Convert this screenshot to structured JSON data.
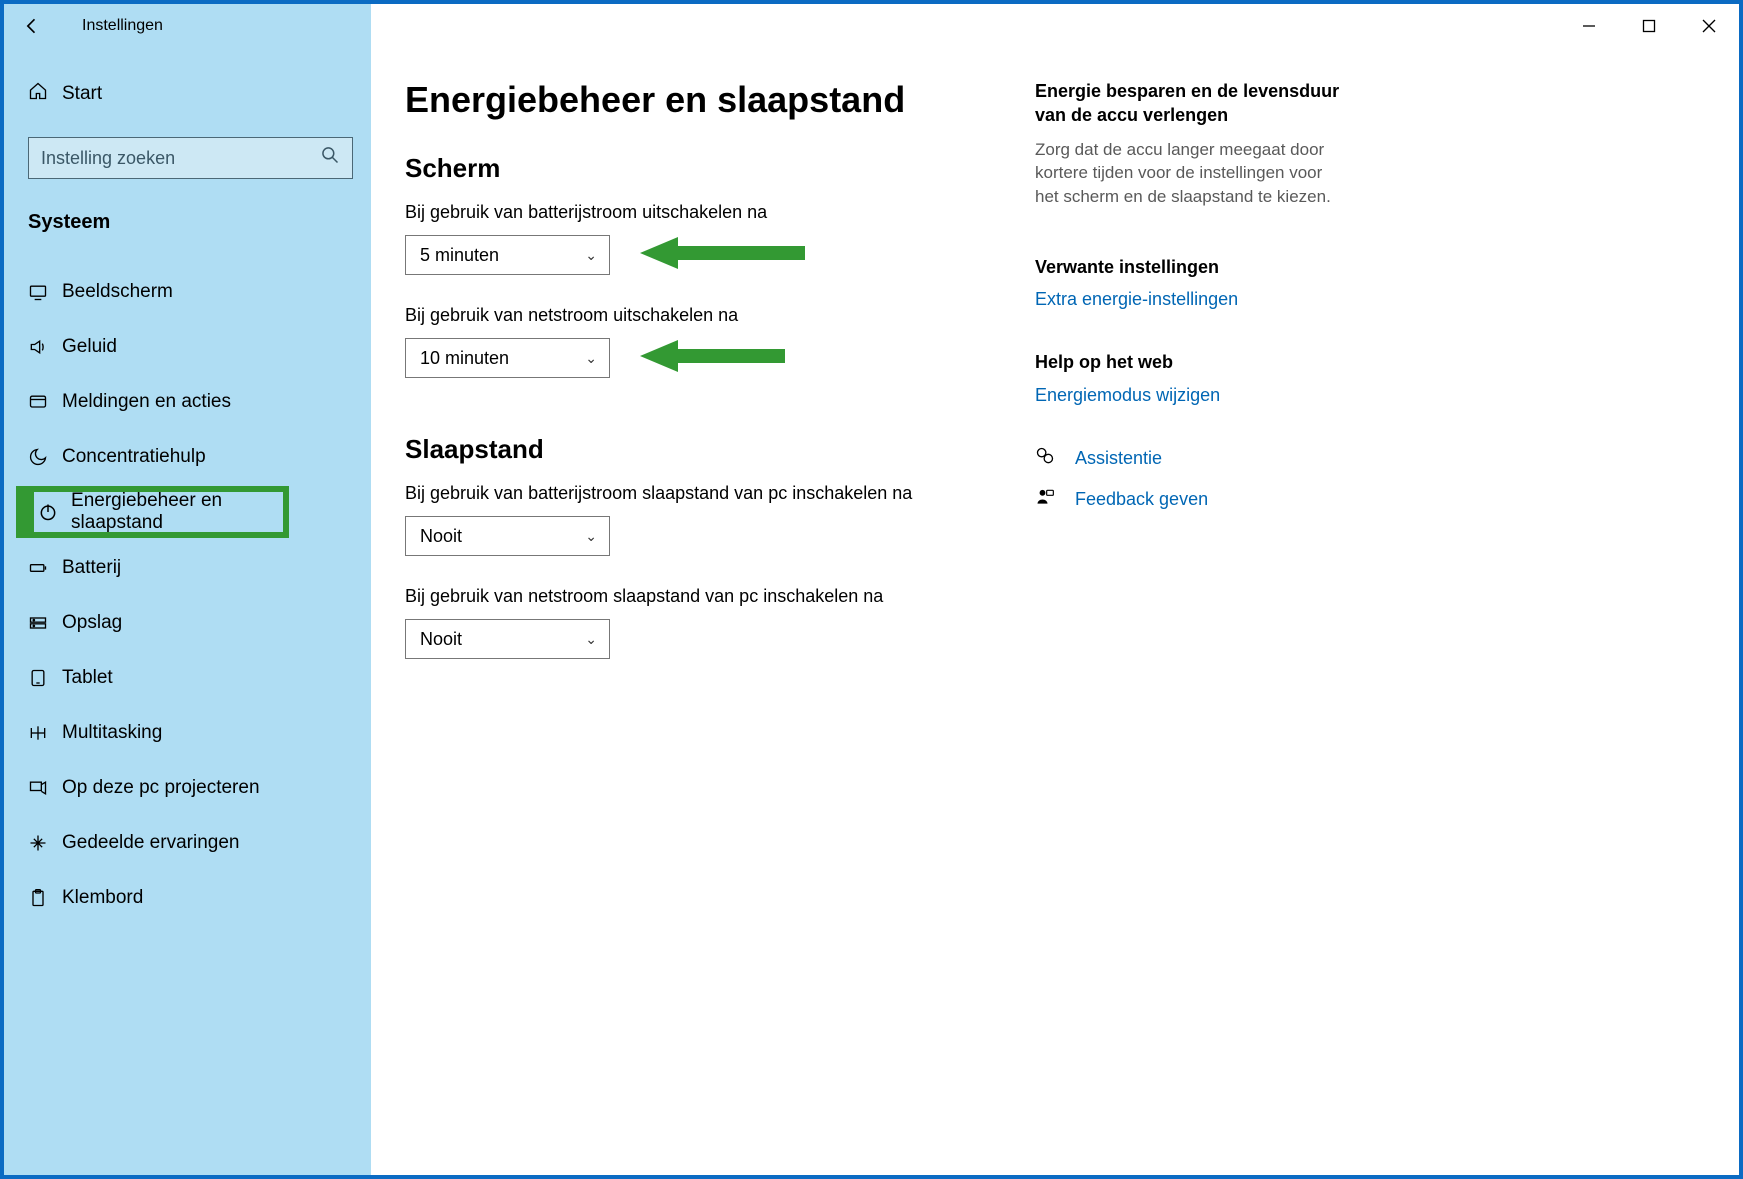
{
  "app_name": "Instellingen",
  "home_label": "Start",
  "search_placeholder": "Instelling zoeken",
  "category": "Systeem",
  "sidebar": [
    {
      "label": "Beeldscherm"
    },
    {
      "label": "Geluid"
    },
    {
      "label": "Meldingen en acties"
    },
    {
      "label": "Concentratiehulp"
    },
    {
      "label": "Energiebeheer en slaapstand"
    },
    {
      "label": "Batterij"
    },
    {
      "label": "Opslag"
    },
    {
      "label": "Tablet"
    },
    {
      "label": "Multitasking"
    },
    {
      "label": "Op deze pc projecteren"
    },
    {
      "label": "Gedeelde ervaringen"
    },
    {
      "label": "Klembord"
    }
  ],
  "page_title": "Energiebeheer en slaapstand",
  "sections": {
    "screen": {
      "title": "Scherm",
      "battery_label": "Bij gebruik van batterijstroom uitschakelen na",
      "battery_value": "5 minuten",
      "plugged_label": "Bij gebruik van netstroom uitschakelen na",
      "plugged_value": "10 minuten"
    },
    "sleep": {
      "title": "Slaapstand",
      "battery_label": "Bij gebruik van batterijstroom slaapstand van pc inschakelen na",
      "battery_value": "Nooit",
      "plugged_label": "Bij gebruik van netstroom slaapstand van pc inschakelen na",
      "plugged_value": "Nooit"
    }
  },
  "aside": {
    "tip_title": "Energie besparen en de levensduur van de accu verlengen",
    "tip_text": "Zorg dat de accu langer meegaat door kortere tijden voor de instellingen voor het scherm en de slaapstand te kiezen.",
    "related_title": "Verwante instellingen",
    "related_link": "Extra energie-instellingen",
    "webhelp_title": "Help op het web",
    "webhelp_link": "Energiemodus wijzigen",
    "support_link": "Assistentie",
    "feedback_link": "Feedback geven"
  }
}
